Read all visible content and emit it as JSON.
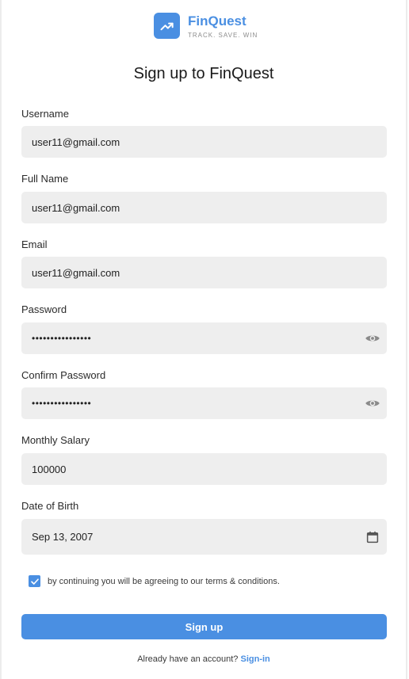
{
  "brand": {
    "name": "FinQuest",
    "tagline": "TRACK. SAVE. WIN",
    "accent_color": "#4a8fe2",
    "logo_icon": "trending-up-icon"
  },
  "page": {
    "title": "Sign up to FinQuest"
  },
  "form": {
    "username": {
      "label": "Username",
      "value": "user11@gmail.com"
    },
    "full_name": {
      "label": "Full Name",
      "value": "user11@gmail.com"
    },
    "email": {
      "label": "Email",
      "value": "user11@gmail.com"
    },
    "password": {
      "label": "Password",
      "value": "••••••••••••••••",
      "toggle_icon": "eye-icon"
    },
    "confirm_password": {
      "label": "Confirm Password",
      "value": "••••••••••••••••",
      "toggle_icon": "eye-icon"
    },
    "monthly_salary": {
      "label": "Monthly Salary",
      "value": "100000"
    },
    "date_of_birth": {
      "label": "Date of Birth",
      "value": "Sep 13, 2007",
      "picker_icon": "calendar-icon"
    },
    "terms": {
      "checked": true,
      "text": "by continuing you will be agreeing to our terms & conditions."
    },
    "submit_label": "Sign up"
  },
  "footer": {
    "prompt": "Already have an account?",
    "link_label": "Sign-in"
  }
}
